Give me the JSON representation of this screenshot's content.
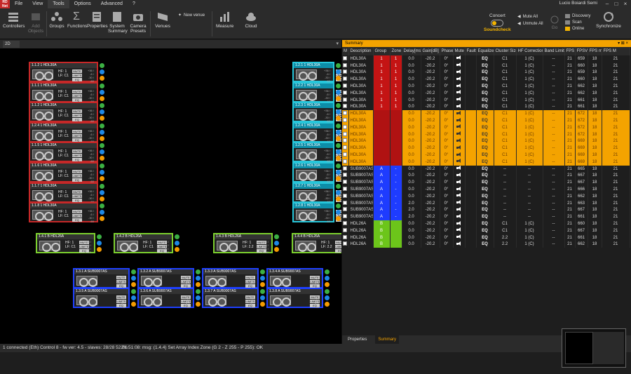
{
  "app": {
    "logo_text": "RD Net",
    "menu": [
      "File",
      "View",
      "Tools",
      "Options",
      "Advanced",
      "?"
    ],
    "active_menu": "Tools",
    "user": "Lucio Boiardi Semi"
  },
  "ribbon": {
    "controllers": "Controllers",
    "add_objects": "Add Objects",
    "groups": "Groups",
    "functions": "Functions",
    "properties": "Properties",
    "system_summary": "System Summary",
    "camera_presets": "Camera Presets",
    "venues": "Venues",
    "new_venue": "New venue",
    "measure": "Measure",
    "cloud": "Cloud",
    "concert": "Concert",
    "soundcheck": "Soundcheck",
    "mute_all": "Mute All",
    "unmute_all": "Unmute All",
    "go": "Go",
    "discovery": "Discovery",
    "scan": "Scan",
    "online": "Online",
    "synchronize": "Synchronize"
  },
  "view2d": {
    "tab": "2D",
    "left_array": [
      {
        "title": "1.1.2 1 HDL30A",
        "hf": "HF: 1",
        "lf": "LF: C1"
      },
      {
        "title": "1.1.1 1 HDL30A",
        "hf": "HF: 1",
        "lf": "LF: C1"
      },
      {
        "title": "1.1.2 1 HDL30A",
        "hf": "HF: 1",
        "lf": "LF: C1"
      },
      {
        "title": "1.2.4 1 HDL30A",
        "hf": "HF: 1",
        "lf": "LF: C1"
      },
      {
        "title": "1.1.5 1 HDL30A",
        "hf": "HF: 1",
        "lf": "LF: C1"
      },
      {
        "title": "1.1.6 1 HDL30A",
        "hf": "HF: 1",
        "lf": "LF: C1"
      },
      {
        "title": "1.1.7 1 HDL30A",
        "hf": "HF: 1",
        "lf": "LF: C1"
      },
      {
        "title": "1.1.8 1 HDL30A",
        "hf": "HF: 1",
        "lf": "LF: C1"
      }
    ],
    "right_array": [
      {
        "title": "1.2.1 1 HDL30A"
      },
      {
        "title": "1.2.2 1 HDL30A"
      },
      {
        "title": "1.2.3 1 HDL30A"
      },
      {
        "title": "1.2.4 1 HDL30A"
      },
      {
        "title": "1.2.5 1 HDL30A"
      },
      {
        "title": "1.2.6 1 HDL30A"
      },
      {
        "title": "1.2.7 1 HDL30A"
      },
      {
        "title": "1.2.8 1 HDL30A"
      }
    ],
    "hdl26": [
      {
        "title": "1.4.1 B HDL26A",
        "hf": "HF: 1",
        "lf": "LF: C1"
      },
      {
        "title": "1.4.2 B HDL26A",
        "hf": "HF: 1",
        "lf": "LF: C1"
      },
      {
        "title": "1.4.3 B HDL26A",
        "hf": "HF: 1",
        "lf": "LF: 2.2"
      },
      {
        "title": "1.4.4 B HDL26A",
        "hf": "HF: 1",
        "lf": "LF: 2.2"
      }
    ],
    "subs": [
      {
        "title": "1.3.1 A SUB9007AS"
      },
      {
        "title": "1.3.2 A SUB9007AS"
      },
      {
        "title": "1.3.3 A SUB9007AS"
      },
      {
        "title": "1.3.4 A SUB9007AS"
      },
      {
        "title": "1.3.8 A SUB9007AS"
      },
      {
        "title": "1.3.7 A SUB9007AS"
      },
      {
        "title": "1.3.6 A SUB9007AS"
      },
      {
        "title": "1.3.5 A SUB9007AS"
      }
    ],
    "btn_mute": "MUTE",
    "btn_limits": "LIMITS",
    "btn_eq": "EQ",
    "meter": "+36 / -6 / -30 / -60"
  },
  "summary": {
    "title": "Summary",
    "columns": [
      "M",
      "Description",
      "Group",
      "Zone",
      "Delay[ms]",
      "Gain[dB]",
      "Phase",
      "Mute",
      "Fault",
      "Equalizer",
      "Cluster Size",
      "HF Correction",
      "Band Limit",
      "FPS",
      "FPSV",
      "FPS m",
      "FPS M"
    ],
    "rows": [
      {
        "desc": "HDL30A",
        "group": "1",
        "zone": "1",
        "delay": "0.0",
        "gain": "-20.2",
        "phase": "0°",
        "eq": "EQ",
        "cluster": "C1",
        "hf": "1 (C)",
        "band": "--",
        "fps": "21",
        "fpsv": "659",
        "fpsm": "18",
        "fpsM": "21",
        "color": "red",
        "sel": false
      },
      {
        "desc": "HDL30A",
        "group": "1",
        "zone": "1",
        "delay": "0.0",
        "gain": "-20.2",
        "phase": "0°",
        "eq": "EQ",
        "cluster": "C1",
        "hf": "1 (C)",
        "band": "--",
        "fps": "21",
        "fpsv": "660",
        "fpsm": "18",
        "fpsM": "21",
        "color": "red",
        "sel": false
      },
      {
        "desc": "HDL30A",
        "group": "1",
        "zone": "1",
        "delay": "0.0",
        "gain": "-20.2",
        "phase": "0°",
        "eq": "EQ",
        "cluster": "C1",
        "hf": "1 (C)",
        "band": "--",
        "fps": "21",
        "fpsv": "659",
        "fpsm": "18",
        "fpsM": "21",
        "color": "red",
        "sel": false
      },
      {
        "desc": "HDL30A",
        "group": "1",
        "zone": "1",
        "delay": "0.0",
        "gain": "-20.2",
        "phase": "0°",
        "eq": "EQ",
        "cluster": "C1",
        "hf": "1 (C)",
        "band": "--",
        "fps": "21",
        "fpsv": "660",
        "fpsm": "18",
        "fpsM": "21",
        "color": "red",
        "sel": false
      },
      {
        "desc": "HDL30A",
        "group": "1",
        "zone": "1",
        "delay": "0.0",
        "gain": "-20.2",
        "phase": "0°",
        "eq": "EQ",
        "cluster": "C1",
        "hf": "1 (C)",
        "band": "--",
        "fps": "21",
        "fpsv": "662",
        "fpsm": "18",
        "fpsM": "21",
        "color": "red",
        "sel": false
      },
      {
        "desc": "HDL30A",
        "group": "1",
        "zone": "1",
        "delay": "0.0",
        "gain": "-20.2",
        "phase": "0°",
        "eq": "EQ",
        "cluster": "C1",
        "hf": "1 (C)",
        "band": "--",
        "fps": "21",
        "fpsv": "662",
        "fpsm": "18",
        "fpsM": "21",
        "color": "red",
        "sel": false
      },
      {
        "desc": "HDL30A",
        "group": "1",
        "zone": "1",
        "delay": "0.0",
        "gain": "-20.2",
        "phase": "0°",
        "eq": "EQ",
        "cluster": "C1",
        "hf": "1 (C)",
        "band": "--",
        "fps": "21",
        "fpsv": "661",
        "fpsm": "18",
        "fpsM": "21",
        "color": "red",
        "sel": false
      },
      {
        "desc": "HDL30A",
        "group": "1",
        "zone": "1",
        "delay": "0.0",
        "gain": "-20.2",
        "phase": "0°",
        "eq": "EQ",
        "cluster": "C1",
        "hf": "1 (C)",
        "band": "--",
        "fps": "21",
        "fpsv": "661",
        "fpsm": "18",
        "fpsM": "21",
        "color": "red",
        "sel": false
      },
      {
        "desc": "HDL30A",
        "group": "",
        "zone": "",
        "delay": "0.0",
        "gain": "-20.2",
        "phase": "0°",
        "eq": "EQ",
        "cluster": "C1",
        "hf": "1 (C)",
        "band": "--",
        "fps": "21",
        "fpsv": "672",
        "fpsm": "18",
        "fpsM": "21",
        "color": "red",
        "sel": true
      },
      {
        "desc": "HDL30A",
        "group": "",
        "zone": "",
        "delay": "0.0",
        "gain": "-20.2",
        "phase": "0°",
        "eq": "EQ",
        "cluster": "C1",
        "hf": "1 (C)",
        "band": "--",
        "fps": "21",
        "fpsv": "672",
        "fpsm": "18",
        "fpsM": "21",
        "color": "red",
        "sel": true
      },
      {
        "desc": "HDL30A",
        "group": "",
        "zone": "",
        "delay": "0.0",
        "gain": "-20.2",
        "phase": "0°",
        "eq": "EQ",
        "cluster": "C1",
        "hf": "1 (C)",
        "band": "--",
        "fps": "21",
        "fpsv": "672",
        "fpsm": "18",
        "fpsM": "21",
        "color": "red",
        "sel": true
      },
      {
        "desc": "HDL30A",
        "group": "",
        "zone": "",
        "delay": "0.0",
        "gain": "-20.2",
        "phase": "0°",
        "eq": "EQ",
        "cluster": "C1",
        "hf": "1 (C)",
        "band": "--",
        "fps": "21",
        "fpsv": "672",
        "fpsm": "18",
        "fpsM": "21",
        "color": "red",
        "sel": true
      },
      {
        "desc": "HDL30A",
        "group": "",
        "zone": "",
        "delay": "0.0",
        "gain": "-20.2",
        "phase": "0°",
        "eq": "EQ",
        "cluster": "C1",
        "hf": "1 (C)",
        "band": "--",
        "fps": "21",
        "fpsv": "669",
        "fpsm": "18",
        "fpsM": "21",
        "color": "red",
        "sel": true
      },
      {
        "desc": "HDL30A",
        "group": "",
        "zone": "",
        "delay": "0.0",
        "gain": "-20.2",
        "phase": "0°",
        "eq": "EQ",
        "cluster": "C1",
        "hf": "1 (C)",
        "band": "--",
        "fps": "21",
        "fpsv": "669",
        "fpsm": "18",
        "fpsM": "21",
        "color": "red",
        "sel": true
      },
      {
        "desc": "HDL30A",
        "group": "",
        "zone": "",
        "delay": "0.0",
        "gain": "-20.2",
        "phase": "0°",
        "eq": "EQ",
        "cluster": "C1",
        "hf": "1 (C)",
        "band": "--",
        "fps": "21",
        "fpsv": "669",
        "fpsm": "18",
        "fpsM": "21",
        "color": "red",
        "sel": true
      },
      {
        "desc": "HDL30A",
        "group": "",
        "zone": "",
        "delay": "0.0",
        "gain": "-20.2",
        "phase": "0°",
        "eq": "EQ",
        "cluster": "C1",
        "hf": "1 (C)",
        "band": "--",
        "fps": "21",
        "fpsv": "669",
        "fpsm": "18",
        "fpsM": "21",
        "color": "red",
        "sel": true
      },
      {
        "desc": "SUB9007AS",
        "group": "A",
        "zone": "-",
        "delay": "0.0",
        "gain": "-20.2",
        "phase": "0°",
        "eq": "EQ",
        "cluster": "--",
        "hf": "--",
        "band": "--",
        "fps": "21",
        "fpsv": "665",
        "fpsm": "18",
        "fpsM": "21",
        "color": "blue",
        "sel": false
      },
      {
        "desc": "SUB9007AS",
        "group": "A",
        "zone": "-",
        "delay": "0.0",
        "gain": "-20.2",
        "phase": "0°",
        "eq": "EQ",
        "cluster": "--",
        "hf": "--",
        "band": "--",
        "fps": "21",
        "fpsv": "667",
        "fpsm": "18",
        "fpsM": "21",
        "color": "blue",
        "sel": false
      },
      {
        "desc": "SUB9007AS",
        "group": "A",
        "zone": "-",
        "delay": "0.0",
        "gain": "-20.2",
        "phase": "0°",
        "eq": "EQ",
        "cluster": "--",
        "hf": "--",
        "band": "--",
        "fps": "21",
        "fpsv": "667",
        "fpsm": "18",
        "fpsM": "21",
        "color": "blue",
        "sel": false
      },
      {
        "desc": "SUB9007AS",
        "group": "A",
        "zone": "-",
        "delay": "0.0",
        "gain": "-20.2",
        "phase": "0°",
        "eq": "EQ",
        "cluster": "--",
        "hf": "--",
        "band": "--",
        "fps": "21",
        "fpsv": "666",
        "fpsm": "18",
        "fpsM": "21",
        "color": "blue",
        "sel": false
      },
      {
        "desc": "SUB9007AS",
        "group": "A",
        "zone": "-",
        "delay": "0.0",
        "gain": "-20.2",
        "phase": "0°",
        "eq": "EQ",
        "cluster": "--",
        "hf": "--",
        "band": "--",
        "fps": "21",
        "fpsv": "662",
        "fpsm": "18",
        "fpsM": "21",
        "color": "blue",
        "sel": false
      },
      {
        "desc": "SUB9007AS",
        "group": "A",
        "zone": "-",
        "delay": "2.0",
        "gain": "-20.2",
        "phase": "0°",
        "eq": "EQ",
        "cluster": "--",
        "hf": "--",
        "band": "--",
        "fps": "21",
        "fpsv": "663",
        "fpsm": "18",
        "fpsM": "21",
        "color": "blue",
        "sel": false
      },
      {
        "desc": "SUB9007AS",
        "group": "A",
        "zone": "-",
        "delay": "2.0",
        "gain": "-20.2",
        "phase": "0°",
        "eq": "EQ",
        "cluster": "--",
        "hf": "--",
        "band": "--",
        "fps": "21",
        "fpsv": "667",
        "fpsm": "18",
        "fpsM": "21",
        "color": "blue",
        "sel": false
      },
      {
        "desc": "SUB9007AS",
        "group": "A",
        "zone": "-",
        "delay": "2.0",
        "gain": "-20.2",
        "phase": "0°",
        "eq": "EQ",
        "cluster": "--",
        "hf": "--",
        "band": "--",
        "fps": "21",
        "fpsv": "661",
        "fpsm": "18",
        "fpsM": "21",
        "color": "blue",
        "sel": false
      },
      {
        "desc": "HDL26A",
        "group": "B",
        "zone": "",
        "delay": "0.0",
        "gain": "-20.2",
        "phase": "0°",
        "eq": "EQ",
        "cluster": "C1",
        "hf": "1 (C)",
        "band": "--",
        "fps": "21",
        "fpsv": "660",
        "fpsm": "18",
        "fpsM": "21",
        "color": "green",
        "sel": false
      },
      {
        "desc": "HDL26A",
        "group": "B",
        "zone": "",
        "delay": "0.0",
        "gain": "-20.2",
        "phase": "0°",
        "eq": "EQ",
        "cluster": "C1",
        "hf": "1 (C)",
        "band": "--",
        "fps": "21",
        "fpsv": "667",
        "fpsm": "18",
        "fpsM": "21",
        "color": "green",
        "sel": false
      },
      {
        "desc": "HDL26A",
        "group": "B",
        "zone": "",
        "delay": "0.0",
        "gain": "-20.2",
        "phase": "0°",
        "eq": "EQ",
        "cluster": "2.2",
        "hf": "1 (C)",
        "band": "--",
        "fps": "21",
        "fpsv": "661",
        "fpsm": "18",
        "fpsM": "21",
        "color": "green",
        "sel": false
      },
      {
        "desc": "HDL26A",
        "group": "B",
        "zone": "",
        "delay": "0.0",
        "gain": "-20.2",
        "phase": "0°",
        "eq": "EQ",
        "cluster": "2.2",
        "hf": "1 (C)",
        "band": "--",
        "fps": "21",
        "fpsv": "662",
        "fpsm": "18",
        "fpsM": "21",
        "color": "green",
        "sel": false
      }
    ],
    "tabs": [
      "Properties",
      "Summary"
    ],
    "active_tab": "Summary"
  },
  "status": {
    "left": "1 connected (Eth) Control 8 - fw ver: 4.5 - slaves: 28/28  522%",
    "message": "01:51:08: msg: (1.4.4) Set Array Index Zone (G 2 - Z 255 - P 255): OK"
  },
  "colors": {
    "accent": "#f4a300",
    "group_red": "#c41414",
    "group_blue": "#1e3cff",
    "group_green": "#6cc51a"
  }
}
